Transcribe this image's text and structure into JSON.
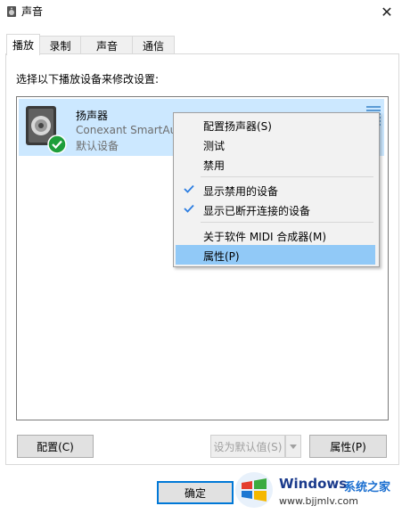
{
  "window": {
    "title": "声音",
    "close_glyph": "✕",
    "title_icon": "speaker-icon",
    "close_icon": "close-icon"
  },
  "tabs": [
    {
      "label": "播放",
      "active": true
    },
    {
      "label": "录制",
      "active": false
    },
    {
      "label": "声音",
      "active": false
    },
    {
      "label": "通信",
      "active": false
    }
  ],
  "instruction": "选择以下播放设备来修改设置:",
  "device": {
    "name": "扬声器",
    "description": "Conexant SmartAudio",
    "status": "默认设备",
    "icon": "speaker-device-icon",
    "status_icon": "green-check-icon"
  },
  "context_menu": {
    "items": [
      {
        "label": "配置扬声器(S)",
        "checked": false,
        "highlighted": false
      },
      {
        "label": "测试",
        "checked": false,
        "highlighted": false
      },
      {
        "label": "禁用",
        "checked": false,
        "highlighted": false
      },
      {
        "label": "显示禁用的设备",
        "checked": true,
        "highlighted": false
      },
      {
        "label": "显示已断开连接的设备",
        "checked": true,
        "highlighted": false
      },
      {
        "label": "关于软件 MIDI 合成器(M)",
        "checked": false,
        "highlighted": false
      },
      {
        "label": "属性(P)",
        "checked": false,
        "highlighted": true
      }
    ]
  },
  "buttons": {
    "configure": "配置(C)",
    "set_default": "设为默认值(S)",
    "properties": "属性(P)",
    "ok": "确定"
  },
  "watermark": {
    "brand": "Windows",
    "brand_cn": "系统之家",
    "url": "www.bjjmlv.com"
  },
  "colors": {
    "selection": "#cce8ff",
    "menu_highlight": "#91c9f7",
    "check": "#2b7de1",
    "default_badge": "#1e9e3a"
  }
}
